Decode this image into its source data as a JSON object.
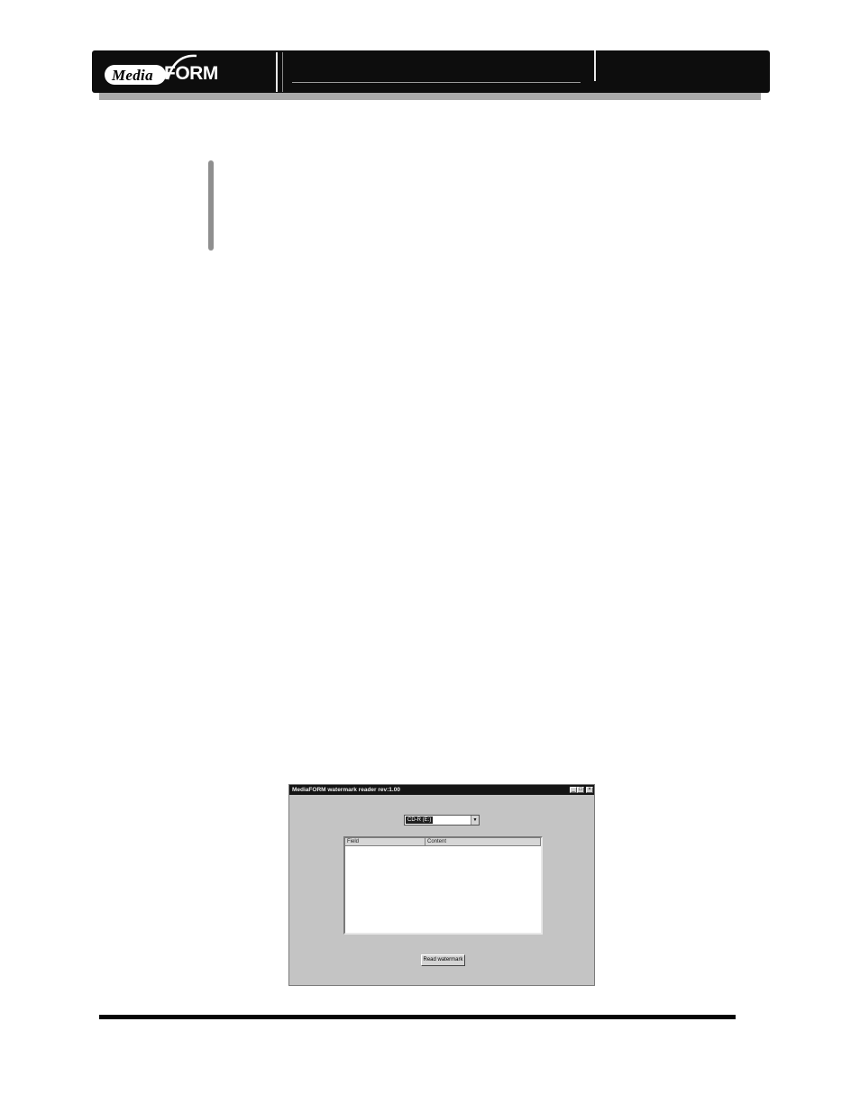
{
  "header": {
    "logo": {
      "media_text": "Media",
      "form_text": "FORM"
    }
  },
  "dialog": {
    "title": "MediaFORM watermark reader rev:1.00",
    "window_buttons": {
      "minimize": "_",
      "maximize": "□",
      "close": "×"
    },
    "drive_select": {
      "value": "CD-R (E:)",
      "arrow": "▼"
    },
    "list": {
      "columns": [
        "Field",
        "Content"
      ],
      "rows": []
    },
    "read_button_label": "Read watermark"
  }
}
